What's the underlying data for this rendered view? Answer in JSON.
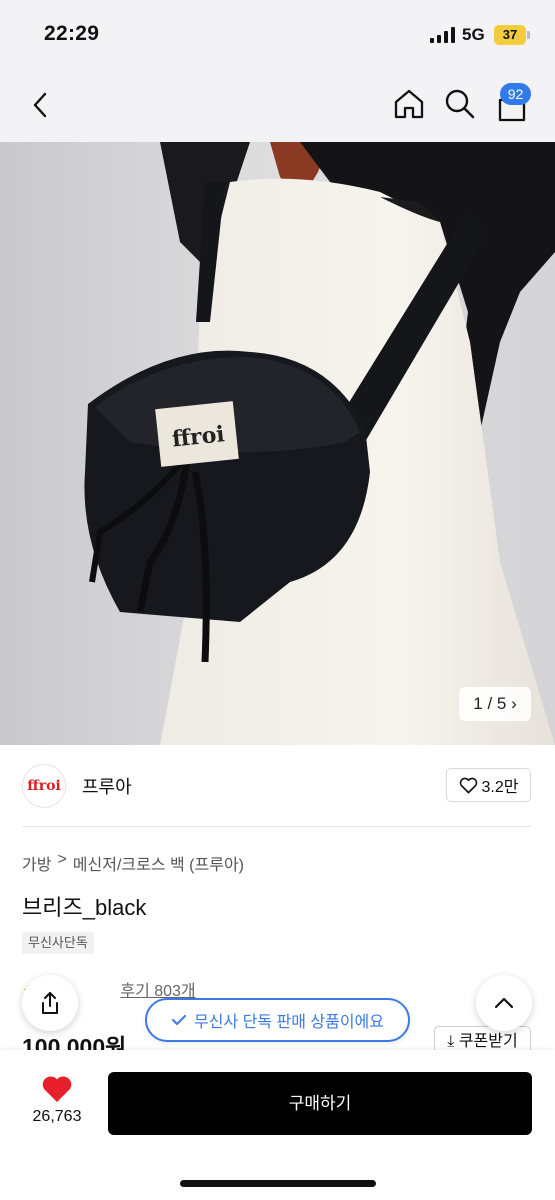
{
  "status_bar": {
    "time": "22:29",
    "network": "5G",
    "battery": "37"
  },
  "nav": {
    "cart_count": "92"
  },
  "image": {
    "logo_text": "ffroi",
    "counter": "1 / 5 ›"
  },
  "brand": {
    "name": "프루아",
    "logo_text": "ffroi",
    "like_count": "3.2만"
  },
  "product": {
    "breadcrumb": [
      "가방",
      ">",
      "메신저/크로스 백 (프루아)"
    ],
    "title": "브리즈_black",
    "badge": "무신사단독",
    "review_label": "후기 803개",
    "price": "100,000원",
    "coupon_label": "⤓ 쿠폰받기"
  },
  "toast": {
    "message": "무신사 단독 판매 상품이에요"
  },
  "bottom_bar": {
    "wish_count": "26,763",
    "buy_label": "구매하기"
  },
  "colors": {
    "accent": "#3b7ae6",
    "badge": "#2f7bea",
    "heart": "#e8202b",
    "brand_logo": "#d61f1f"
  }
}
